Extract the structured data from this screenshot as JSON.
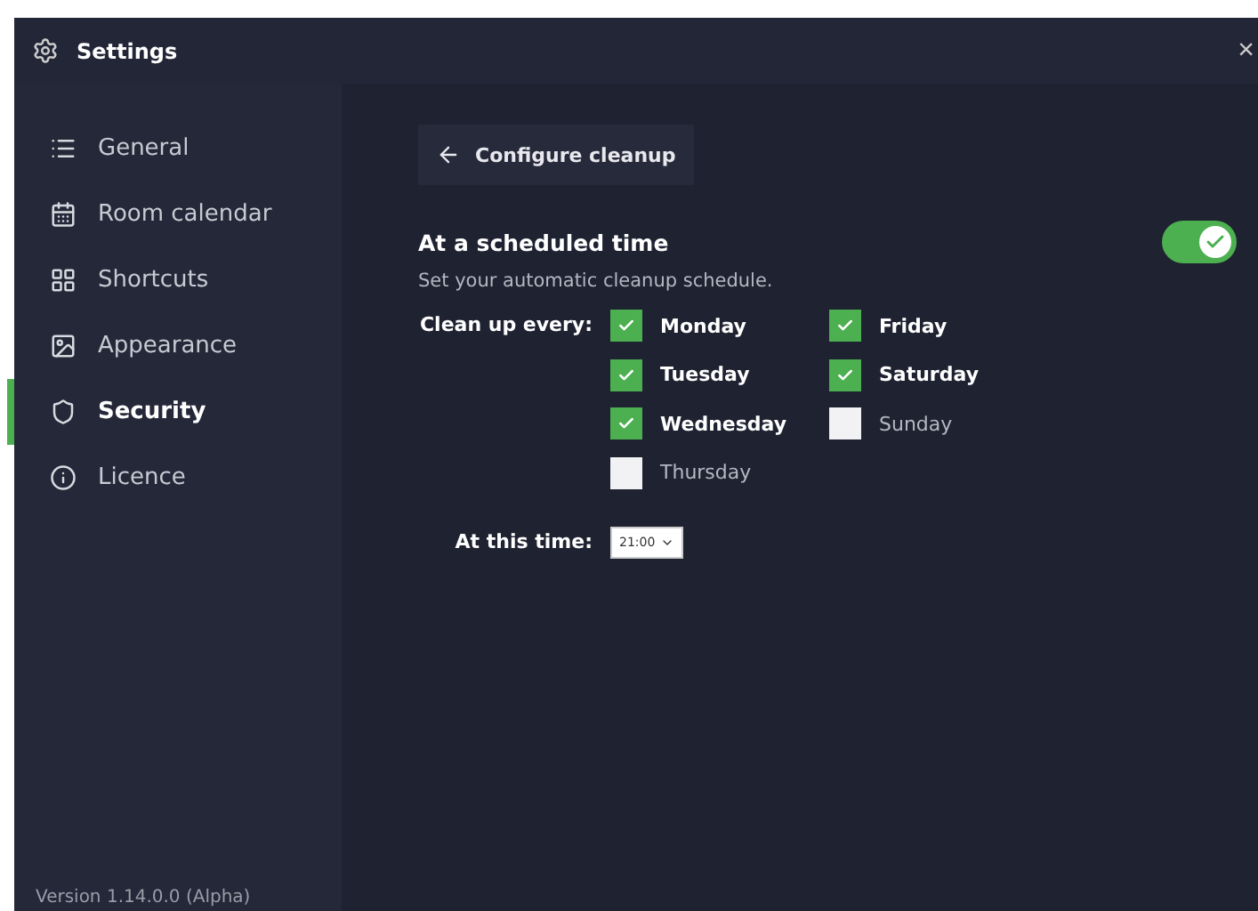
{
  "window": {
    "title": "Settings",
    "close": "×"
  },
  "sidebar": {
    "items": [
      {
        "label": "General",
        "selected": false
      },
      {
        "label": "Room calendar",
        "selected": false
      },
      {
        "label": "Shortcuts",
        "selected": false
      },
      {
        "label": "Appearance",
        "selected": false
      },
      {
        "label": "Security",
        "selected": true
      },
      {
        "label": "Licence",
        "selected": false
      }
    ],
    "version": "Version 1.14.0.0 (Alpha)"
  },
  "page": {
    "back_button": "Configure cleanup",
    "section": {
      "title": "At a scheduled time",
      "subtitle": "Set your automatic cleanup schedule.",
      "on": true
    },
    "days_label": "Clean up every:",
    "days": [
      {
        "label": "Monday",
        "checked": true
      },
      {
        "label": "Tuesday",
        "checked": true
      },
      {
        "label": "Wednesday",
        "checked": true
      },
      {
        "label": "Thursday",
        "checked": false
      },
      {
        "label": "Friday",
        "checked": true
      },
      {
        "label": "Saturday",
        "checked": true
      },
      {
        "label": "Sunday",
        "checked": false
      }
    ],
    "time_label": "At this time:",
    "time_value": "21:00"
  }
}
